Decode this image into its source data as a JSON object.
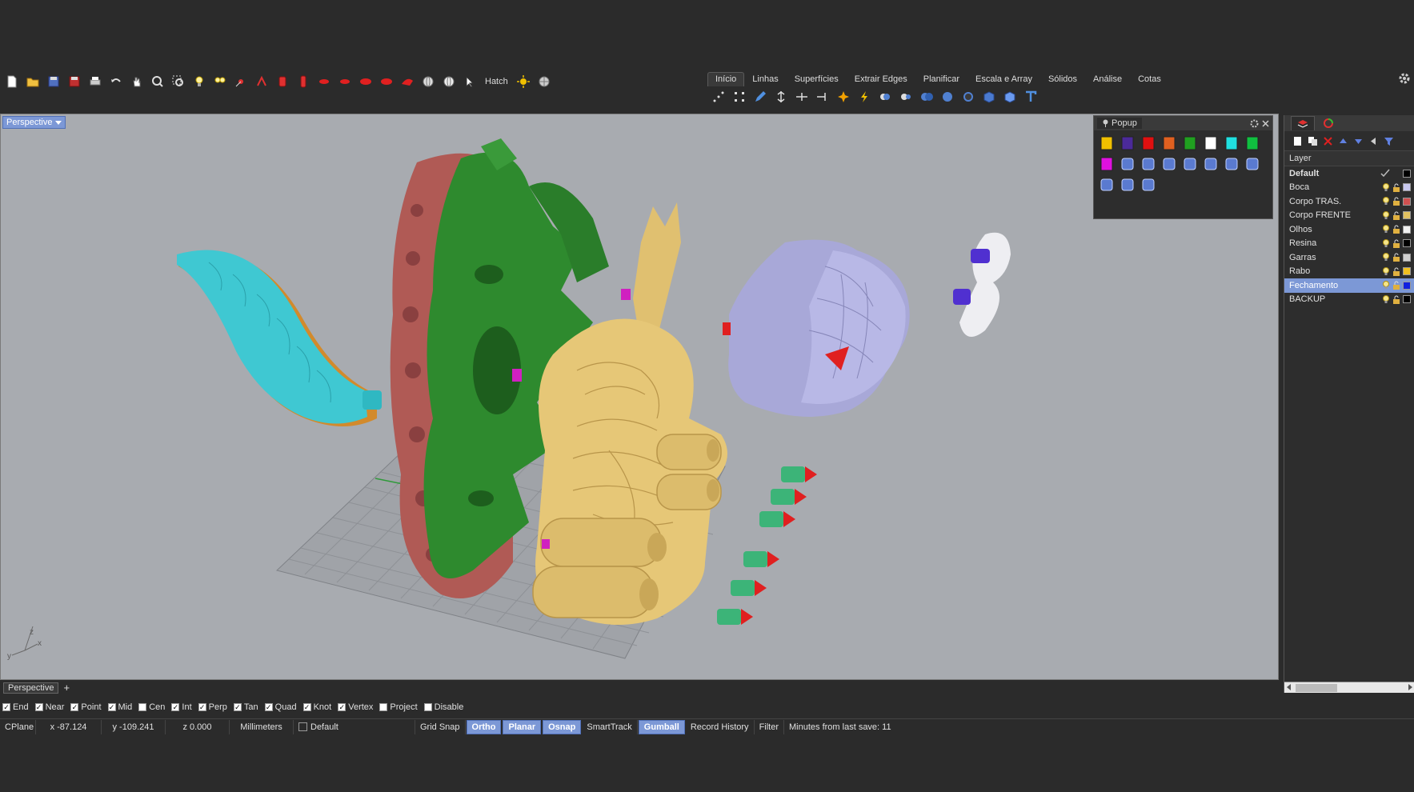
{
  "toolbar": {
    "hatch_label": "Hatch",
    "icons": [
      "new-file-icon",
      "open-folder-icon",
      "save-icon",
      "save-as-icon",
      "print-icon",
      "undo-icon",
      "pan-hand-icon",
      "zoom-icon",
      "zoom-window-icon",
      "light-bulb-icon",
      "light-bulbs-icon",
      "point-icon",
      "snap-icon",
      "cylinder-icon",
      "cylinder-alt-icon",
      "lips-icon",
      "lips-alt-icon",
      "lips-3-icon",
      "lips-4-icon",
      "lips-5-icon",
      "sphere-icon",
      "sphere-alt-icon",
      "cursor-icon"
    ]
  },
  "tabs": {
    "items": [
      {
        "label": "Início",
        "active": true
      },
      {
        "label": "Linhas",
        "active": false
      },
      {
        "label": "Superfícies",
        "active": false
      },
      {
        "label": "Extrair Edges",
        "active": false
      },
      {
        "label": "Planificar",
        "active": false
      },
      {
        "label": "Escala e Array",
        "active": false
      },
      {
        "label": "Sólidos",
        "active": false
      },
      {
        "label": "Análise",
        "active": false
      },
      {
        "label": "Cotas",
        "active": false
      }
    ]
  },
  "viewport": {
    "title": "Perspective",
    "axis_x": "x",
    "axis_y": "y",
    "axis_z": "z"
  },
  "popup": {
    "title": "Popup",
    "colors": [
      "#f0c000",
      "#4b2a9a",
      "#e01010",
      "#e06020",
      "#20a020",
      "#ffffff",
      "#20e0e0",
      "#10c040",
      "#e010e0"
    ]
  },
  "layers": {
    "header": "Layer",
    "rows": [
      {
        "name": "Default",
        "bold": true,
        "selected": false,
        "color": "#000000",
        "current": true
      },
      {
        "name": "Boca",
        "bold": false,
        "selected": false,
        "color": "#c8c8f0"
      },
      {
        "name": "Corpo TRAS.",
        "bold": false,
        "selected": false,
        "color": "#d05050"
      },
      {
        "name": "Corpo FRENTE",
        "bold": false,
        "selected": false,
        "color": "#e0c060"
      },
      {
        "name": "Olhos",
        "bold": false,
        "selected": false,
        "color": "#f0f0f0"
      },
      {
        "name": "Resina",
        "bold": false,
        "selected": false,
        "color": "#000000"
      },
      {
        "name": "Garras",
        "bold": false,
        "selected": false,
        "color": "#d0d0d0"
      },
      {
        "name": "Rabo",
        "bold": false,
        "selected": false,
        "color": "#f0c020"
      },
      {
        "name": "Fechamento",
        "bold": false,
        "selected": true,
        "color": "#1020e0"
      },
      {
        "name": "BACKUP",
        "bold": false,
        "selected": false,
        "color": "#000000"
      }
    ]
  },
  "viewport_tabs": {
    "active": "Perspective",
    "add": "+"
  },
  "osnap": [
    {
      "label": "End",
      "checked": true
    },
    {
      "label": "Near",
      "checked": true
    },
    {
      "label": "Point",
      "checked": true
    },
    {
      "label": "Mid",
      "checked": true
    },
    {
      "label": "Cen",
      "checked": false
    },
    {
      "label": "Int",
      "checked": true
    },
    {
      "label": "Perp",
      "checked": true
    },
    {
      "label": "Tan",
      "checked": true
    },
    {
      "label": "Quad",
      "checked": true
    },
    {
      "label": "Knot",
      "checked": true
    },
    {
      "label": "Vertex",
      "checked": true
    },
    {
      "label": "Project",
      "checked": false
    },
    {
      "label": "Disable",
      "checked": false
    }
  ],
  "status": {
    "cplane": "CPlane",
    "x": "x -87.124",
    "y": "y -109.241",
    "z": "z 0.000",
    "units": "Millimeters",
    "layer": "Default",
    "grid_snap": "Grid Snap",
    "ortho": "Ortho",
    "planar": "Planar",
    "osnap": "Osnap",
    "smarttrack": "SmartTrack",
    "gumball": "Gumball",
    "record_history": "Record History",
    "filter": "Filter",
    "last_save": "Minutes from last save: 11"
  }
}
